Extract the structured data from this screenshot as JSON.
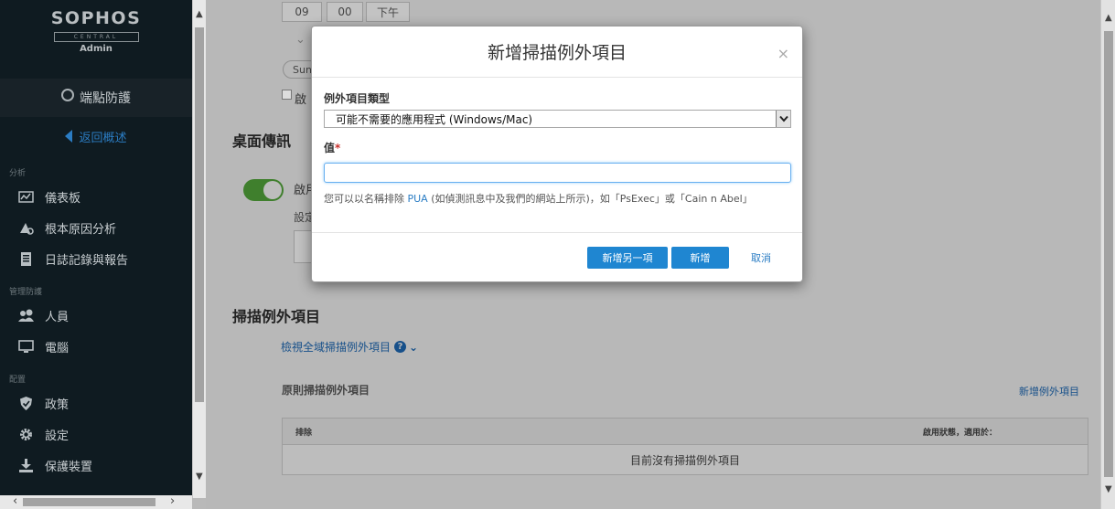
{
  "brand": {
    "name": "SOPHOS",
    "sub": "CENTRAL",
    "role": "Admin"
  },
  "sidebar": {
    "section_title": "端點防護",
    "back_label": "返回概述",
    "groups": [
      {
        "title": "分析",
        "items": [
          "儀表板",
          "根本原因分析",
          "日誌記錄與報告"
        ]
      },
      {
        "title": "管理防護",
        "items": [
          "人員",
          "電腦"
        ]
      },
      {
        "title": "配置",
        "items": [
          "政策",
          "設定",
          "保護裝置"
        ]
      }
    ]
  },
  "background": {
    "time": {
      "hour": "09",
      "minute": "00",
      "ampm": "下午"
    },
    "day_chip": "Sun",
    "checkbox_label": "啟",
    "desktop_messaging_title": "桌面傳訊",
    "toggle_label": "啟用",
    "toggle_on": true,
    "setting_label": "設定",
    "scan_exclusions_title": "掃描例外項目",
    "view_global_link": "檢視全域掃描例外項目",
    "policy_exclusions_title": "原則掃描例外項目",
    "add_exclusion_link": "新增例外項目",
    "table": {
      "col1": "排除",
      "col2": "啟用狀態，適用於：",
      "empty_text": "目前沒有掃描例外項目"
    }
  },
  "modal": {
    "title": "新增掃描例外項目",
    "close_glyph": "×",
    "type_label": "例外項目類型",
    "type_value": "可能不需要的應用程式 (Windows/Mac)",
    "value_label": "值",
    "required_mark": "*",
    "value_input": "",
    "help_prefix": "您可以以名稱排除 ",
    "help_link": "PUA",
    "help_suffix": " (如偵測訊息中及我們的網站上所示)，如「PsExec」或「Cain n Abel」",
    "buttons": {
      "add_another": "新增另一項",
      "add": "新增",
      "cancel": "取消"
    }
  },
  "colors": {
    "sidebar_bg": "#0f1b21",
    "accent": "#1f86d1",
    "link": "#2b7dc4",
    "toggle_on": "#3f7f2d"
  }
}
